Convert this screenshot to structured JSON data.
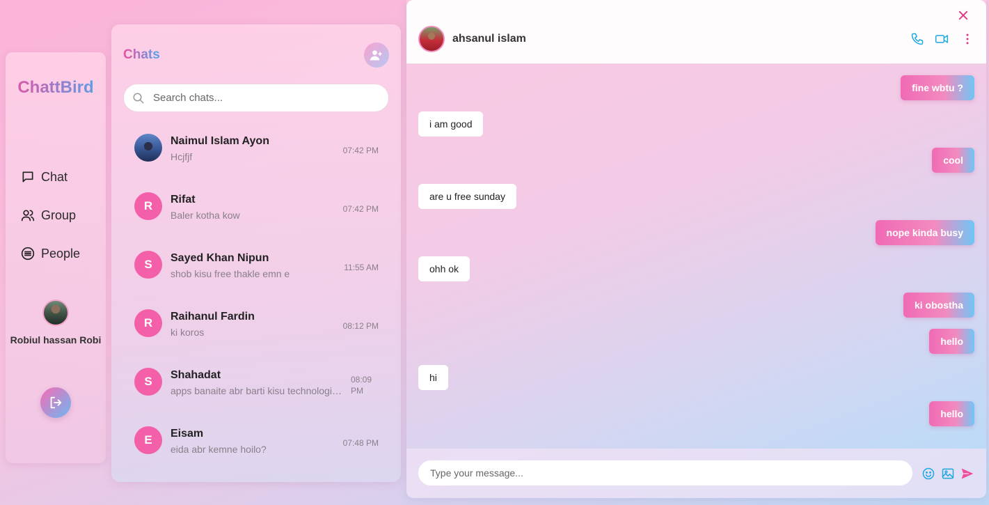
{
  "nav": {
    "brand": "ChattBird",
    "items": [
      {
        "label": "Chat",
        "icon": "message-square-icon"
      },
      {
        "label": "Group",
        "icon": "users-icon"
      },
      {
        "label": "People",
        "icon": "list-circle-icon"
      }
    ],
    "user": {
      "name": "Robiul hassan Robi"
    }
  },
  "chats": {
    "title": "Chats",
    "search_placeholder": "Search chats...",
    "items": [
      {
        "name": "Naimul Islam Ayon",
        "preview": "Hcjfjf",
        "time": "07:42 PM",
        "initial": ""
      },
      {
        "name": "Rifat",
        "preview": "Baler kotha kow",
        "time": "07:42 PM",
        "initial": "R"
      },
      {
        "name": "Sayed Khan Nipun",
        "preview": "shob kisu free thakle emn e",
        "time": "11:55 AM",
        "initial": "S"
      },
      {
        "name": "Raihanul Fardin",
        "preview": "ki koros",
        "time": "08:12 PM",
        "initial": "R"
      },
      {
        "name": "Shahadat",
        "preview": "apps banaite abr barti kisu technologies lage",
        "time": "08:09 PM",
        "initial": "S"
      },
      {
        "name": "Eisam",
        "preview": "eida abr kemne hoilo?",
        "time": "07:48 PM",
        "initial": "E"
      }
    ]
  },
  "conversation": {
    "peer_name": "ahsanul islam",
    "messages": [
      {
        "text": "fine wbtu ?",
        "dir": "out"
      },
      {
        "text": "i am good",
        "dir": "in"
      },
      {
        "text": "cool",
        "dir": "out"
      },
      {
        "text": "are u free sunday",
        "dir": "in"
      },
      {
        "text": "nope kinda busy",
        "dir": "out"
      },
      {
        "text": "ohh ok",
        "dir": "in"
      },
      {
        "text": "ki obostha",
        "dir": "out"
      },
      {
        "text": "hello",
        "dir": "out"
      },
      {
        "text": "hi",
        "dir": "in"
      },
      {
        "text": "hello",
        "dir": "out"
      }
    ],
    "composer_placeholder": "Type your message..."
  },
  "colors": {
    "accent_pink": "#f35fa8",
    "accent_blue": "#4aa8ef"
  }
}
